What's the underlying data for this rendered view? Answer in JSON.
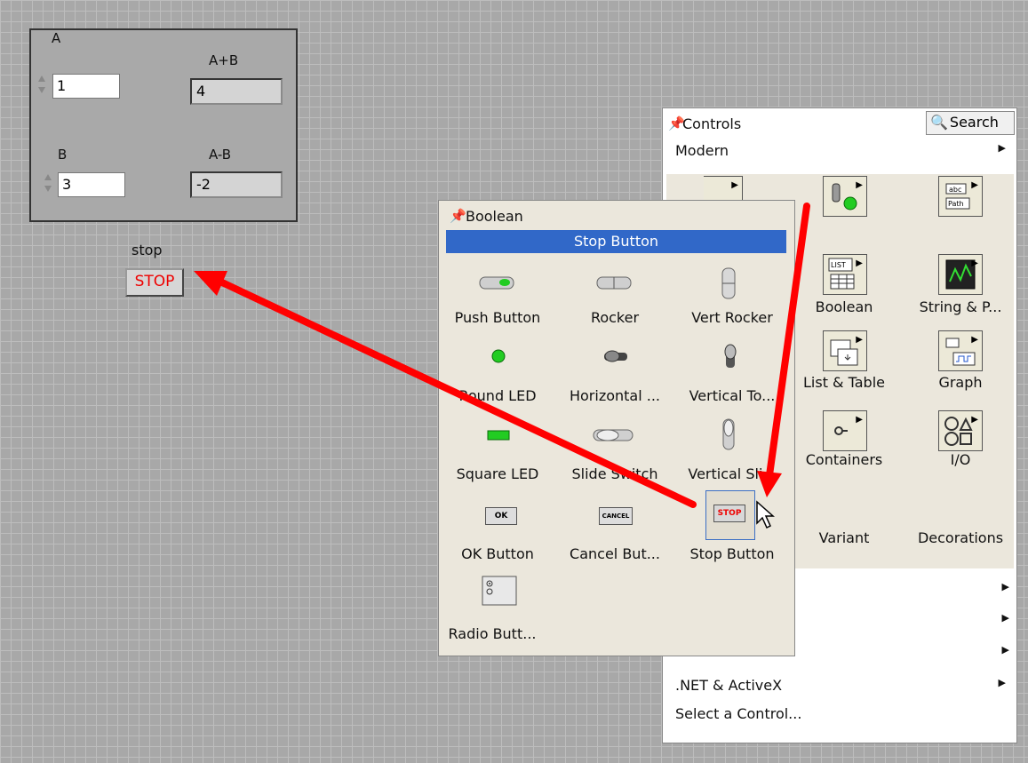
{
  "front_panel": {
    "a_label": "A",
    "a_value": "1",
    "b_label": "B",
    "b_value": "3",
    "sum_label": "A+B",
    "sum_value": "4",
    "diff_label": "A-B",
    "diff_value": "-2",
    "stop_label": "stop",
    "stop_button": "STOP"
  },
  "controls_palette": {
    "title": "Controls",
    "search_label": "Search",
    "modern_label": "Modern",
    "items": [
      {
        "label": "Boolean",
        "icon": "toggle-led-icon"
      },
      {
        "label": "String & P...",
        "icon": "string-path-icon"
      },
      {
        "label": "List & Table",
        "icon": "list-table-icon"
      },
      {
        "label": "Graph",
        "icon": "graph-icon"
      },
      {
        "label": "Containers",
        "icon": "containers-icon"
      },
      {
        "label": "I/O",
        "icon": "io-icon"
      },
      {
        "label": "Variant",
        "icon": "variant-icon"
      },
      {
        "label": "Decorations",
        "icon": "decorations-icon"
      }
    ],
    "bottom_menu": [
      {
        "label": ".NET & ActiveX"
      },
      {
        "label": "Select a Control..."
      }
    ]
  },
  "boolean_palette": {
    "title": "Boolean",
    "highlight": "Stop Button",
    "items": [
      {
        "label": "Push Button"
      },
      {
        "label": "Rocker"
      },
      {
        "label": "Vert Rocker"
      },
      {
        "label": "Round LED"
      },
      {
        "label": "Horizontal ..."
      },
      {
        "label": "Vertical To..."
      },
      {
        "label": "Square LED"
      },
      {
        "label": "Slide Switch"
      },
      {
        "label": "Vertical Sli..."
      },
      {
        "label": "OK Button"
      },
      {
        "label": "Cancel But..."
      },
      {
        "label": "Stop Button"
      },
      {
        "label": "Radio Butt..."
      }
    ],
    "ok_text": "OK",
    "cancel_text": "CANCEL",
    "stop_text": "STOP"
  },
  "colors": {
    "arrow": "#ff0000",
    "highlight": "#3168c8",
    "panel_grid": "#a8a8a8"
  }
}
